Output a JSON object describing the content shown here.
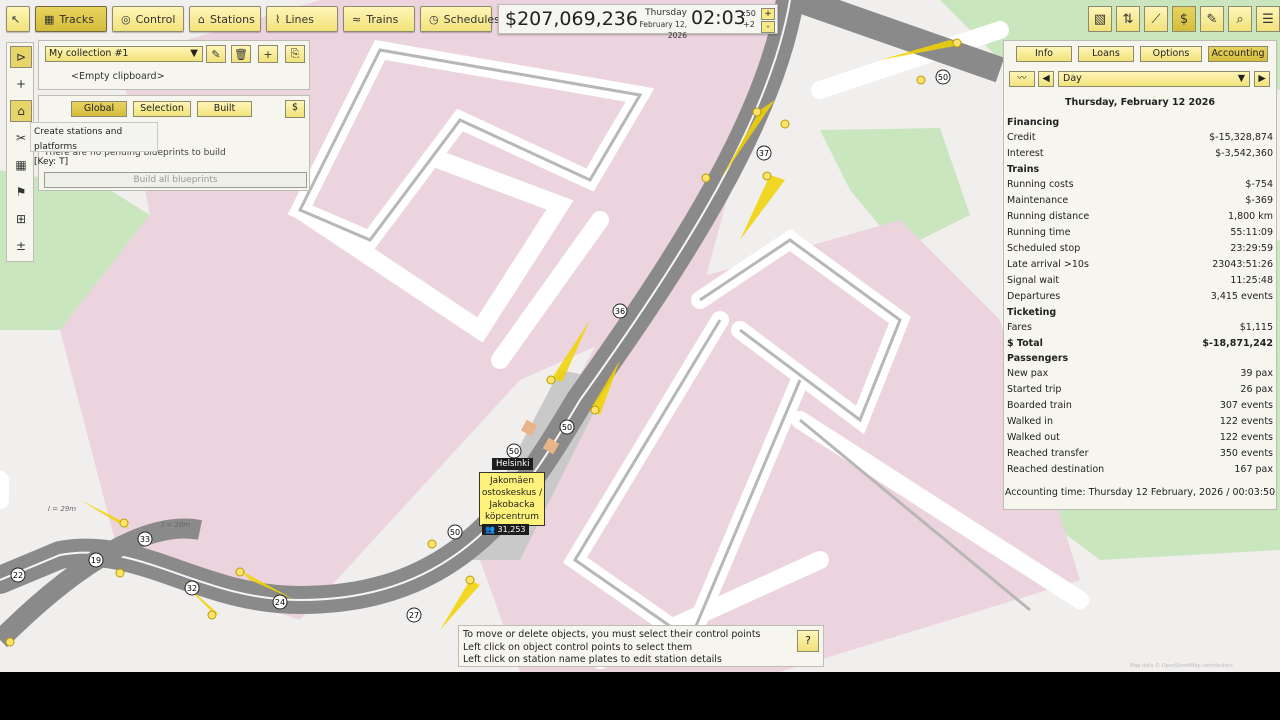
{
  "toolbar": {
    "tracks": "Tracks",
    "control": "Control",
    "stations": "Stations",
    "lines": "Lines",
    "trains": "Trains",
    "schedules": "Schedules"
  },
  "status": {
    "money": "$207,069,236",
    "weekday": "Thursday",
    "date": "February 12, 2026",
    "time": "02:03",
    "seconds": ":50",
    "speed": "+2",
    "plus": "+",
    "minus": "-"
  },
  "collection": {
    "selected": "My collection #1",
    "clipboard": "<Empty clipboard>"
  },
  "blueprints": {
    "global": "Global",
    "selection": "Selection",
    "built": "Built",
    "no_pending": "There are no pending blueprints to build",
    "build_all": "Build all blueprints"
  },
  "tooltip": {
    "title": "Create stations and platforms",
    "key": "[Key: T]"
  },
  "accounting": {
    "tabs": [
      "Info",
      "Loans",
      "Options",
      "Accounting"
    ],
    "period": "Day",
    "date": "Thursday, February 12 2026",
    "rows": [
      {
        "label": "Financing",
        "value": "",
        "head": true
      },
      {
        "label": "Credit",
        "value": "$-15,328,874"
      },
      {
        "label": "Interest",
        "value": "$-3,542,360"
      },
      {
        "label": "Trains",
        "value": "",
        "head": true
      },
      {
        "label": "Running costs",
        "value": "$-754"
      },
      {
        "label": "Maintenance",
        "value": "$-369"
      },
      {
        "label": "Running distance",
        "value": "1,800 km"
      },
      {
        "label": "Running time",
        "value": "55:11:09"
      },
      {
        "label": "Scheduled stop",
        "value": "23:29:59"
      },
      {
        "label": "Late arrival >10s",
        "value": "23043:51:26"
      },
      {
        "label": "Signal wait",
        "value": "11:25:48"
      },
      {
        "label": "Departures",
        "value": "3,415 events"
      },
      {
        "label": "Ticketing",
        "value": "",
        "head": true
      },
      {
        "label": "Fares",
        "value": "$1,115"
      },
      {
        "label": "$ Total",
        "value": "$-18,871,242",
        "head": true
      },
      {
        "label": "Passengers",
        "value": "",
        "head": true
      },
      {
        "label": "New pax",
        "value": "39 pax"
      },
      {
        "label": "Started trip",
        "value": "26 pax"
      },
      {
        "label": "Boarded train",
        "value": "307 events"
      },
      {
        "label": "Walked in",
        "value": "122 events"
      },
      {
        "label": "Walked out",
        "value": "122 events"
      },
      {
        "label": "Reached transfer",
        "value": "350 events"
      },
      {
        "label": "Reached destination",
        "value": "167 pax"
      }
    ],
    "footer": "Accounting time: Thursday 12 February, 2026 / 00:03:50"
  },
  "hint": {
    "line1": "To move or delete objects, you must select their control points",
    "line2": "Left click on object control points to select them",
    "line3": "Left click on station name plates to edit station details",
    "btn": "?"
  },
  "station": {
    "city": "Helsinki",
    "name": "Jakomäen ostoskeskus / Jakobacka köpcentrum",
    "pax": "31,253"
  },
  "map": {
    "speed_signs": [
      "50",
      "37",
      "36",
      "50",
      "50",
      "50",
      "33",
      "19",
      "22",
      "32",
      "24",
      "27"
    ],
    "distance_labels": [
      "I = 29m",
      "I = 20m"
    ],
    "credit": "Map data © OpenStreetMap contributors"
  }
}
